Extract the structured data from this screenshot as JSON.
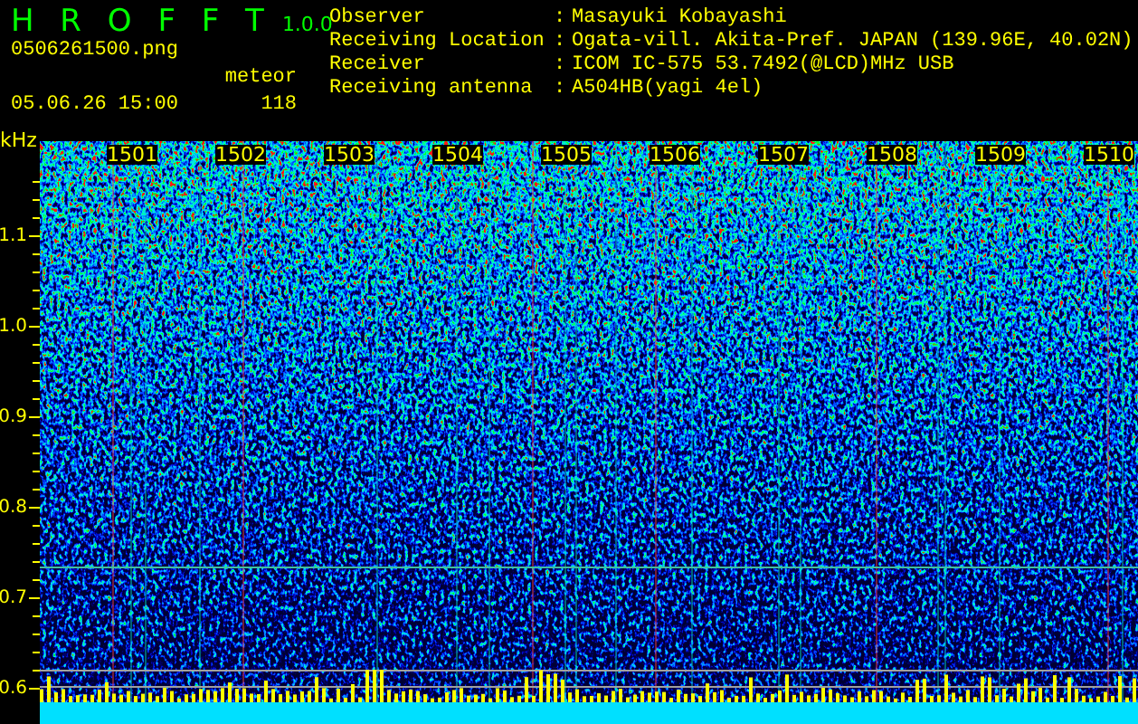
{
  "app": {
    "title": "H R O F F T",
    "version": "1.0.0"
  },
  "file": "0506261500.png",
  "datetime": "05.06.26 15:00",
  "meteor": {
    "label": "meteor",
    "count": "118"
  },
  "info": [
    {
      "label": "Observer",
      "separator": ":",
      "value": "Masayuki Kobayashi"
    },
    {
      "label": "Receiving Location",
      "separator": ":",
      "value": "Ogata-vill. Akita-Pref. JAPAN (139.96E, 40.02N)"
    },
    {
      "label": "Receiver",
      "separator": ":",
      "value": "ICOM IC-575 53.7492(@LCD)MHz USB"
    },
    {
      "label": "Receiving antenna",
      "separator": ":",
      "value": "A504HB(yagi 4el)"
    }
  ],
  "axis": {
    "unit": "kHz",
    "y_labels": [
      "1.1",
      "1.0",
      "0.9",
      "0.8",
      "0.7",
      "0.6"
    ],
    "time_labels": [
      "1501",
      "1502",
      "1503",
      "1504",
      "1505",
      "1506",
      "1507",
      "1508",
      "1509",
      "1510"
    ]
  }
}
